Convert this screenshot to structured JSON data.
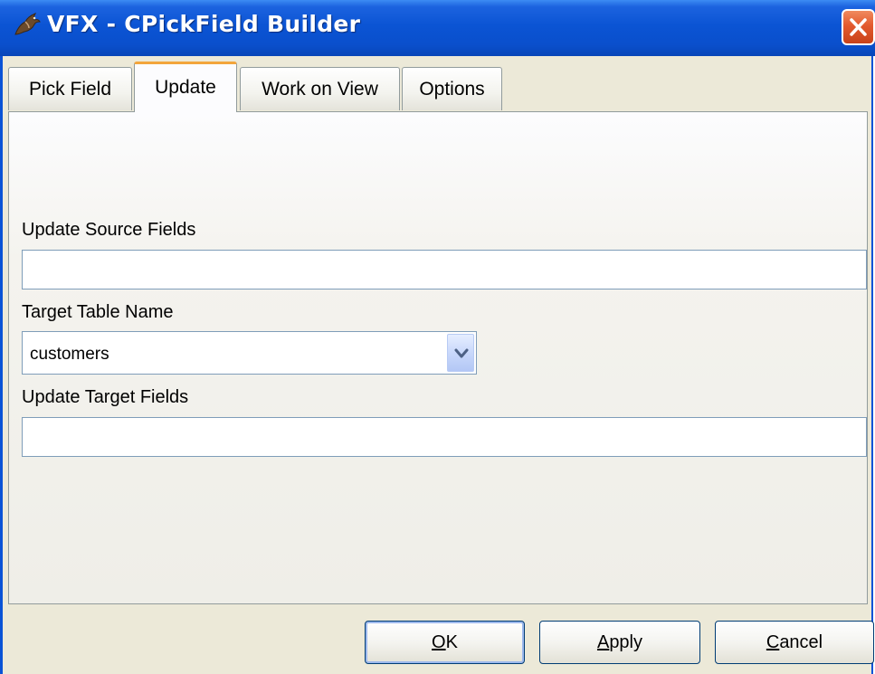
{
  "window": {
    "title": "VFX - CPickField Builder",
    "icon": "app-logo-icon",
    "close_icon": "close-icon"
  },
  "tabs": [
    {
      "label": "Pick Field",
      "active": false
    },
    {
      "label": "Update",
      "active": true
    },
    {
      "label": "Work on View",
      "active": false
    },
    {
      "label": "Options",
      "active": false
    }
  ],
  "form": {
    "update_source_label": "Update Source Fields",
    "update_source_value": "",
    "target_table_label": "Target Table Name",
    "target_table_value": "customers",
    "update_target_label": "Update Target Fields",
    "update_target_value": ""
  },
  "buttons": {
    "ok": {
      "prefix": "",
      "accel": "O",
      "rest": "K"
    },
    "apply": {
      "prefix": "",
      "accel": "A",
      "rest": "pply"
    },
    "cancel": {
      "prefix": "",
      "accel": "C",
      "rest": "ancel"
    }
  },
  "colors": {
    "titlebar": "#0b54d4",
    "close": "#e35a2e",
    "tab_highlight": "#f3a53c",
    "field_border": "#7f9db9"
  }
}
